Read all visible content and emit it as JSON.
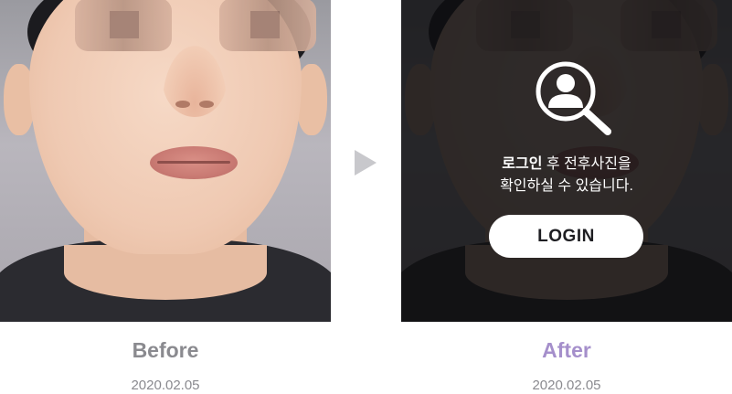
{
  "before": {
    "label": "Before",
    "date": "2020.02.05"
  },
  "after": {
    "label": "After",
    "date": "2020.02.05",
    "message_bold": "로그인",
    "message_rest_line1": " 후 전후사진을",
    "message_line2": "확인하실 수 있습니다.",
    "login_button": "LOGIN"
  },
  "icons": {
    "arrow": "play-triangle-right",
    "lock": "magnifier-user"
  },
  "colors": {
    "after_label": "#a58fcb",
    "before_label": "#8a8a8f",
    "date": "#8a8a8f",
    "overlay": "#0e0e10",
    "button_bg": "#ffffff"
  }
}
